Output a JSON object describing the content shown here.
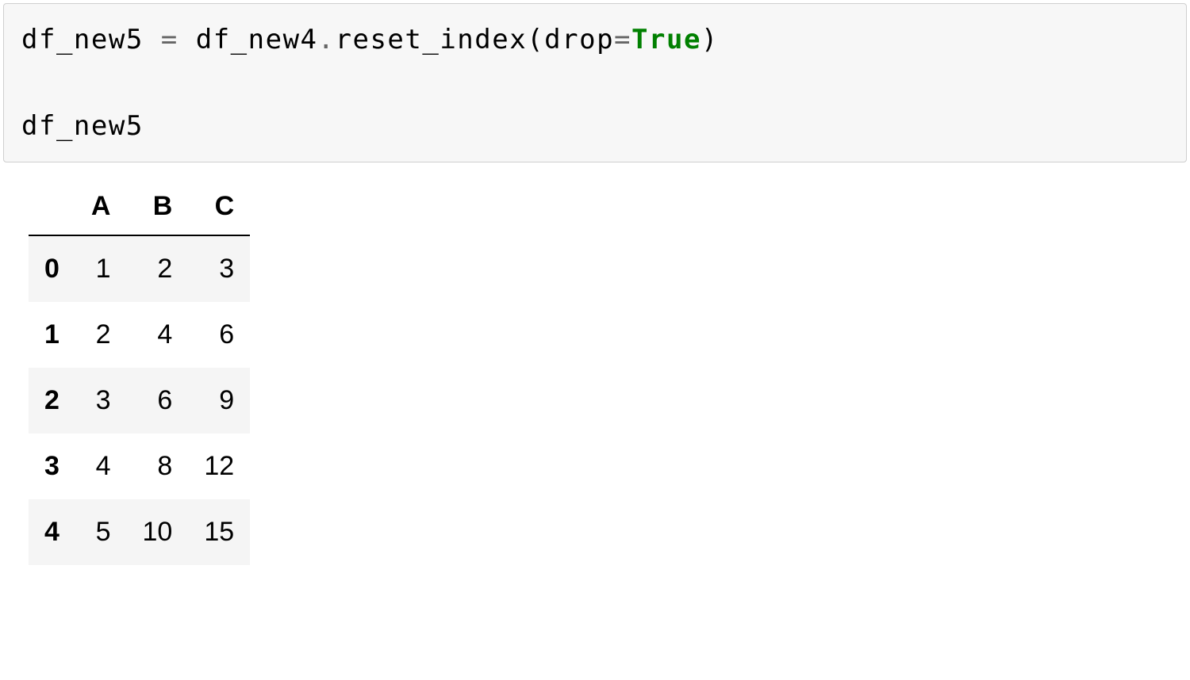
{
  "code": {
    "var1": "df_new5",
    "op_eq": " = ",
    "var2": "df_new4",
    "dot": ".",
    "method": "reset_index",
    "paren_open": "(",
    "arg_name": "drop",
    "arg_eq": "=",
    "arg_val": "True",
    "paren_close": ")",
    "line2": "df_new5"
  },
  "table": {
    "index_name": "",
    "columns": [
      "A",
      "B",
      "C"
    ],
    "index": [
      "0",
      "1",
      "2",
      "3",
      "4"
    ],
    "rows": [
      [
        "1",
        "2",
        "3"
      ],
      [
        "2",
        "4",
        "6"
      ],
      [
        "3",
        "6",
        "9"
      ],
      [
        "4",
        "8",
        "12"
      ],
      [
        "5",
        "10",
        "15"
      ]
    ]
  }
}
